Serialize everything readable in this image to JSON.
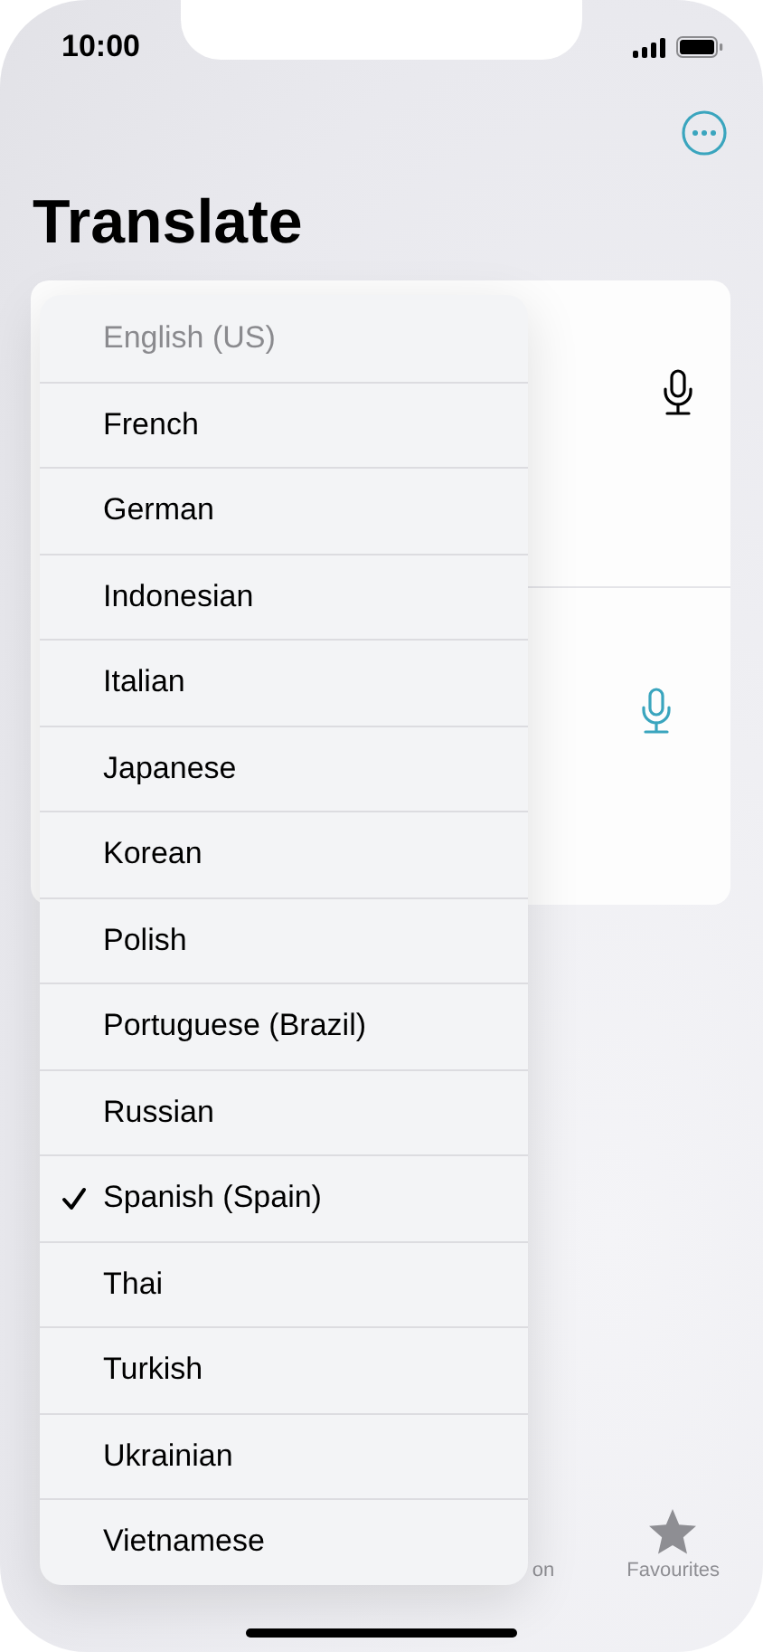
{
  "status_bar": {
    "time": "10:00"
  },
  "title": "Translate",
  "panels": [
    {
      "mic_active": false
    },
    {
      "mic_active": true
    }
  ],
  "language_menu": [
    {
      "label": "English (US)",
      "disabled": true,
      "selected": false
    },
    {
      "label": "French",
      "disabled": false,
      "selected": false
    },
    {
      "label": "German",
      "disabled": false,
      "selected": false
    },
    {
      "label": "Indonesian",
      "disabled": false,
      "selected": false
    },
    {
      "label": "Italian",
      "disabled": false,
      "selected": false
    },
    {
      "label": "Japanese",
      "disabled": false,
      "selected": false
    },
    {
      "label": "Korean",
      "disabled": false,
      "selected": false
    },
    {
      "label": "Polish",
      "disabled": false,
      "selected": false
    },
    {
      "label": "Portuguese (Brazil)",
      "disabled": false,
      "selected": false
    },
    {
      "label": "Russian",
      "disabled": false,
      "selected": false
    },
    {
      "label": "Spanish (Spain)",
      "disabled": false,
      "selected": true
    },
    {
      "label": "Thai",
      "disabled": false,
      "selected": false
    },
    {
      "label": "Turkish",
      "disabled": false,
      "selected": false
    },
    {
      "label": "Ukrainian",
      "disabled": false,
      "selected": false
    },
    {
      "label": "Vietnamese",
      "disabled": false,
      "selected": false
    }
  ],
  "tab_bar": [
    {
      "label": "on",
      "kind": "plain"
    },
    {
      "label": "Favourites",
      "kind": "star"
    }
  ]
}
